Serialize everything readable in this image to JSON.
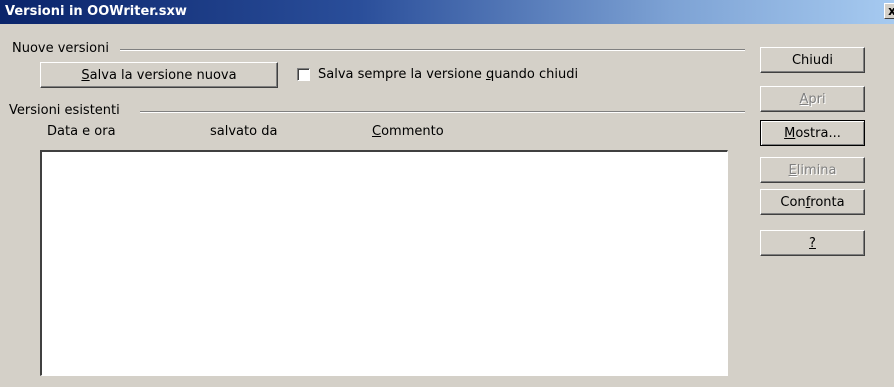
{
  "window": {
    "title": "Versioni in OOWriter.sxw",
    "close_glyph": "x"
  },
  "new_versions": {
    "group_label": "Nuove versioni",
    "save_button": {
      "pre": "",
      "mnemonic": "S",
      "post": "alva la versione nuova"
    },
    "always_save": {
      "pre": "Salva sempre la versione ",
      "mnemonic": "q",
      "post": "uando chiudi",
      "checked": false
    }
  },
  "existing_versions": {
    "group_label": "Versioni esistenti",
    "columns": {
      "date": {
        "pre": "Data e ora",
        "mnemonic": "",
        "post": ""
      },
      "saved_by": {
        "pre": "salvato da",
        "mnemonic": "",
        "post": ""
      },
      "comment": {
        "pre": "",
        "mnemonic": "C",
        "post": "ommento"
      }
    },
    "rows": []
  },
  "buttons": {
    "close": {
      "pre": "Chiudi",
      "mnemonic": "",
      "post": "",
      "enabled": true
    },
    "open": {
      "pre": "",
      "mnemonic": "A",
      "post": "pri",
      "enabled": false
    },
    "show": {
      "pre": "",
      "mnemonic": "M",
      "post": "ostra...",
      "enabled": true
    },
    "delete": {
      "pre": "",
      "mnemonic": "E",
      "post": "limina",
      "enabled": false
    },
    "compare": {
      "pre": "Con",
      "mnemonic": "f",
      "post": "ronta",
      "enabled": true
    },
    "help": {
      "pre": "",
      "mnemonic": "?",
      "post": "",
      "enabled": true
    }
  }
}
